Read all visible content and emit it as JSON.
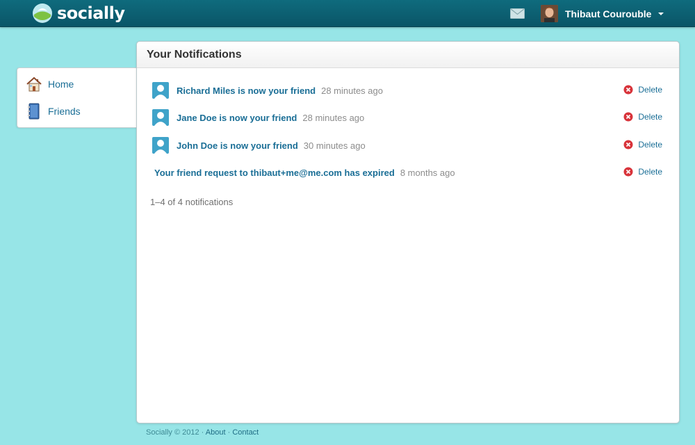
{
  "app": {
    "name": "socially"
  },
  "header": {
    "user_name": "Thibaut Courouble"
  },
  "sidebar": {
    "items": [
      {
        "label": "Home",
        "icon": "house-icon"
      },
      {
        "label": "Friends",
        "icon": "address-book-icon"
      }
    ]
  },
  "notifications": {
    "title": "Your Notifications",
    "items": [
      {
        "text": "Richard Miles is now your friend",
        "time": "28 minutes ago",
        "delete_label": "Delete"
      },
      {
        "text": "Jane Doe is now your friend",
        "time": "28 minutes ago",
        "delete_label": "Delete"
      },
      {
        "text": "John Doe is now your friend",
        "time": "30 minutes ago",
        "delete_label": "Delete"
      },
      {
        "text": "Your friend request to thibaut+me@me.com has expired",
        "time": "8 months ago",
        "delete_label": "Delete"
      }
    ],
    "count_text": "1–4 of 4 notifications"
  },
  "footer": {
    "copyright": "Socially © 2012",
    "links": [
      "About",
      "Contact"
    ],
    "separator": "·"
  },
  "colors": {
    "background": "#97e5e7",
    "topbar": "#0f6b7d",
    "link": "#1a6e96",
    "delete_icon": "#d8333a"
  }
}
